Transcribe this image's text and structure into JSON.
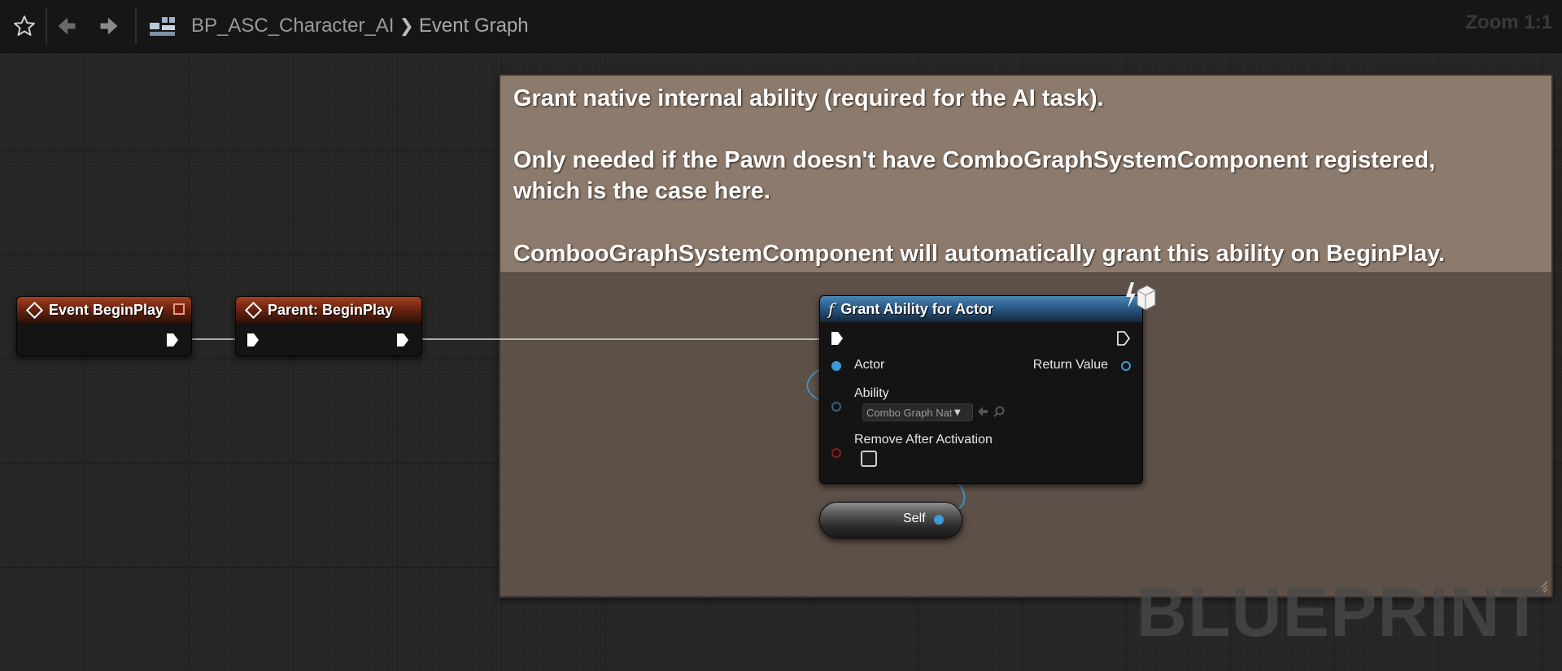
{
  "toolbar": {
    "breadcrumb_blueprint": "BP_ASC_Character_AI",
    "breadcrumb_graph": "Event Graph",
    "zoom_label": "Zoom 1:1",
    "icons": [
      "star-icon",
      "back-arrow-icon",
      "forward-arrow-icon",
      "blueprint-graph-icon"
    ]
  },
  "comment": {
    "lines": [
      "Grant native internal ability (required for the AI task).",
      "Only needed if the Pawn doesn't have ComboGraphSystemComponent registered,",
      "which is the case here.",
      "CombooGraphSystemComponent will automatically grant this ability on BeginPlay."
    ],
    "color": "#8c7a6c"
  },
  "nodes": {
    "event_beginplay": {
      "title": "Event BeginPlay"
    },
    "parent_beginplay": {
      "title": "Parent: BeginPlay"
    },
    "grant_ability": {
      "title": "Grant Ability for Actor",
      "pin_actor": "Actor",
      "pin_return": "Return Value",
      "pin_ability": "Ability",
      "ability_value": "Combo Graph Nat",
      "pin_remove": "Remove After Activation",
      "remove_checked": false
    },
    "self": {
      "label": "Self"
    }
  },
  "watermark": "BLUEPRINT",
  "colors": {
    "event_header": "#a24020",
    "function_header": "#4a86b4",
    "object_pin": "#3c9ad6",
    "class_pin": "#3a5f80",
    "bool_pin": "#8c1a1a"
  }
}
